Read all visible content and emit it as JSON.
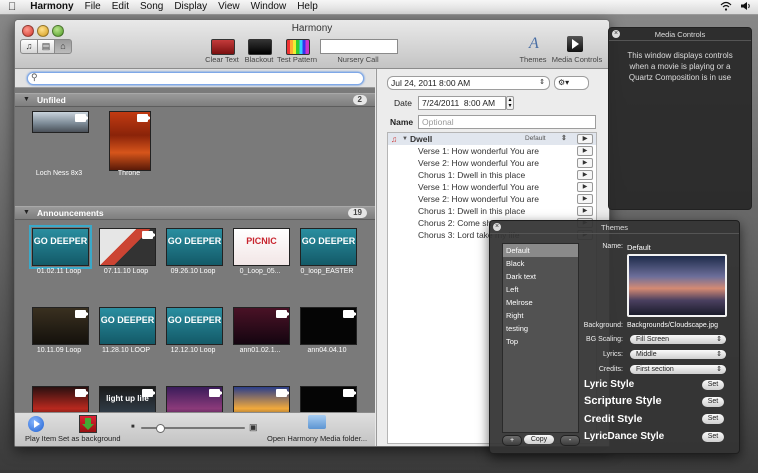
{
  "menubar": {
    "app": "Harmony",
    "items": [
      "File",
      "Edit",
      "Song",
      "Display",
      "View",
      "Window",
      "Help"
    ]
  },
  "window": {
    "title": "Harmony",
    "toolbar": {
      "clear_text": "Clear Text",
      "blackout": "Blackout",
      "test_pattern": "Test Pattern",
      "nursery_call": "Nursery Call",
      "themes": "Themes",
      "media_controls": "Media Controls"
    }
  },
  "library": {
    "search_placeholder": "",
    "unfiled": {
      "title": "Unfiled",
      "count": "2",
      "items": [
        {
          "caption": "Loch Ness 8x3"
        },
        {
          "caption": "Throne"
        }
      ]
    },
    "announcements": {
      "title": "Announcements",
      "count": "19",
      "items": [
        {
          "caption": "01.02.11 Loop",
          "text": "GO DEEPER",
          "kind": "teal",
          "selected": true
        },
        {
          "caption": "07.11.10 Loop",
          "text": "",
          "kind": "collage"
        },
        {
          "caption": "09.26.10 Loop",
          "text": "GO DEEPER",
          "kind": "teal"
        },
        {
          "caption": "0_Loop_05...",
          "text": "PICNIC",
          "kind": "picnic"
        },
        {
          "caption": "0_loop_EASTER",
          "text": "GO DEEPER",
          "kind": "teal"
        },
        {
          "caption": "10.11.09 Loop",
          "text": "",
          "kind": "dark"
        },
        {
          "caption": "11.28.10 LOOP",
          "text": "GO DEEPER",
          "kind": "teal"
        },
        {
          "caption": "12.12.10 Loop",
          "text": "GO DEEPER",
          "kind": "teal"
        },
        {
          "caption": "ann01.02.1...",
          "text": "",
          "kind": "concert"
        },
        {
          "caption": "ann04.04.10",
          "text": "",
          "kind": "black"
        },
        {
          "caption": "",
          "text": "",
          "kind": "red"
        },
        {
          "caption": "",
          "text": "light up life",
          "kind": "lightup"
        },
        {
          "caption": "",
          "text": "",
          "kind": "purple"
        },
        {
          "caption": "",
          "text": "",
          "kind": "sign"
        },
        {
          "caption": "",
          "text": "",
          "kind": "black"
        }
      ]
    },
    "footer": {
      "play_item": "Play Item",
      "set_background": "Set as background",
      "open_folder": "Open Harmony Media folder..."
    }
  },
  "service": {
    "date_select": "Jul 24, 2011 8:00 AM",
    "date_label": "Date",
    "date_value": "7/24/2011",
    "time_value": "8:00 AM",
    "name_label": "Name",
    "name_placeholder": "Optional",
    "song_title": "Dwell",
    "song_theme": "Default",
    "slides": [
      "Verse 1: How wonderful You are",
      "Verse 2: How wonderful You are",
      "Chorus 1: Dwell in this place",
      "Verse 1: How wonderful You are",
      "Verse 2: How wonderful You are",
      "Chorus 1: Dwell in this place",
      "Chorus 2: Come sh...",
      "Chorus 3: Lord take my life"
    ]
  },
  "media_controls": {
    "title": "Media Controls",
    "message": "This window displays controls when a movie is playing or a Quartz Composition is in use"
  },
  "themes": {
    "title": "Themes",
    "list": [
      "Default",
      "Black",
      "Dark text",
      "Left",
      "Melrose",
      "Right",
      "testing",
      "Top"
    ],
    "selected": "Default",
    "name_label": "Name:",
    "name_value": "Default",
    "background_label": "Background:",
    "background_value": "Backgrounds/Cloudscape.jpg",
    "bg_scaling_label": "BG Scaling:",
    "bg_scaling_value": "Fill Screen",
    "lyrics_label": "Lyrics:",
    "lyrics_value": "Middle",
    "credits_label": "Credits:",
    "credits_value": "First section",
    "styles": [
      {
        "name": "Lyric Style",
        "button": "Set"
      },
      {
        "name": "Scripture Style",
        "button": "Set"
      },
      {
        "name": "Credit Style",
        "button": "Set"
      },
      {
        "name": "LyricDance Style",
        "button": "Set"
      }
    ],
    "add_button": "+",
    "copy_button": "Copy",
    "remove_button": "-"
  },
  "colors": {
    "accent_selection": "#3aa9c9",
    "teal_slide": "#1d6f7e",
    "picnic_red": "#c8242e"
  }
}
